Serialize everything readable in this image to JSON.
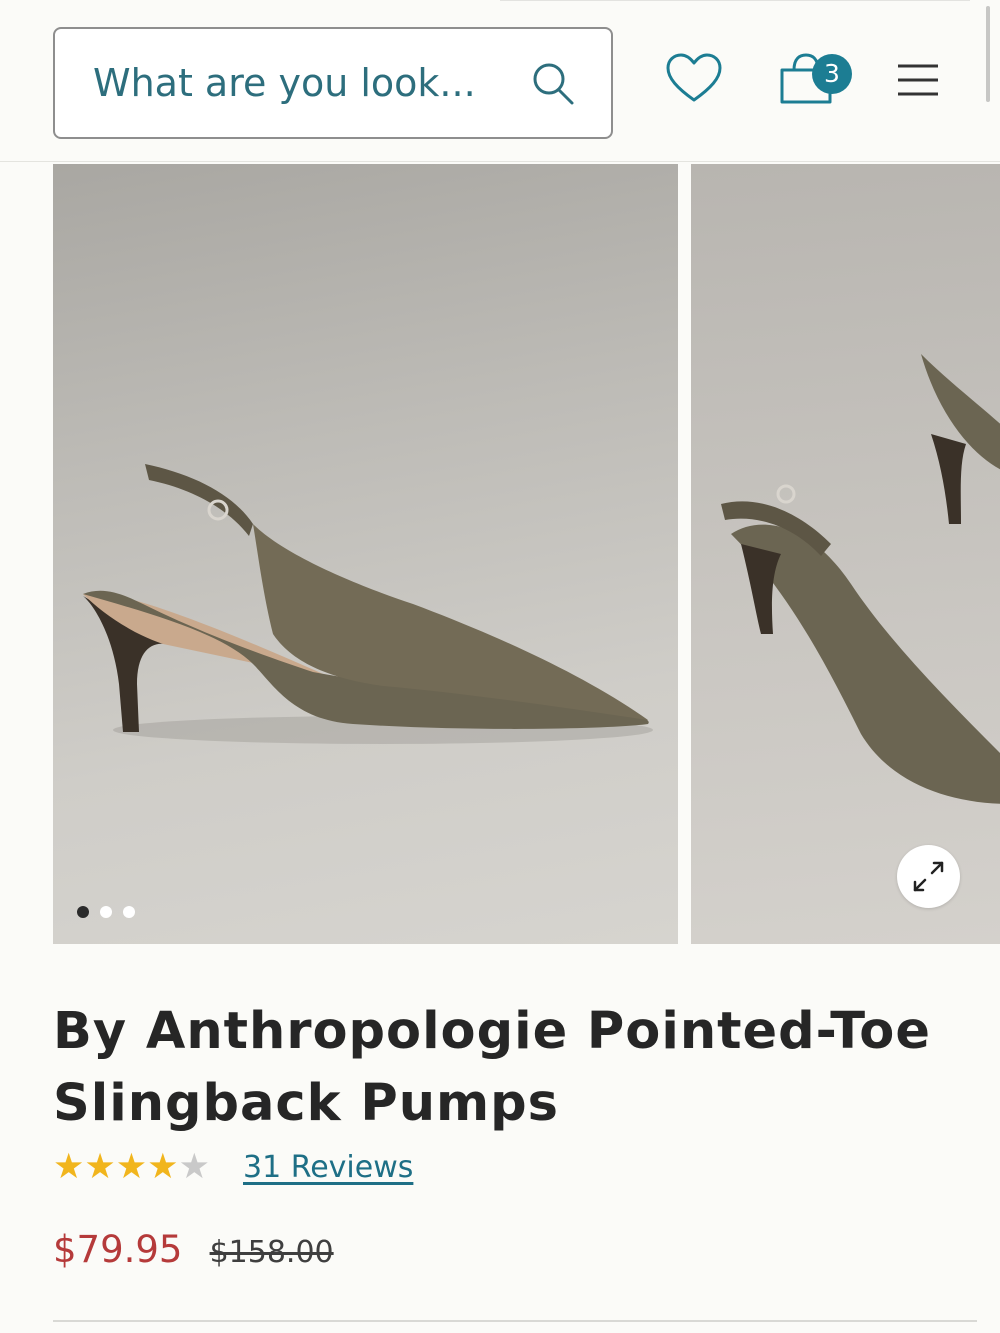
{
  "header": {
    "search": {
      "placeholder": "What are you look...",
      "icon": "search-icon"
    },
    "wishlist_icon": "heart-icon",
    "cart": {
      "icon": "shopping-bag-icon",
      "count": "3"
    },
    "menu_icon": "hamburger-menu-icon"
  },
  "gallery": {
    "dots_total": 3,
    "active_dot": 1,
    "expand_icon": "expand-icon"
  },
  "product": {
    "title": "By Anthropologie Pointed-Toe Slingback Pumps",
    "rating": 4,
    "rating_max": 5,
    "reviews_label": "31 Reviews",
    "sale_price": "$79.95",
    "original_price": "$158.00"
  },
  "colors": {
    "accent_teal": "#1c7d93",
    "star_gold": "#f1b51d",
    "sale_red": "#b53a3a"
  }
}
